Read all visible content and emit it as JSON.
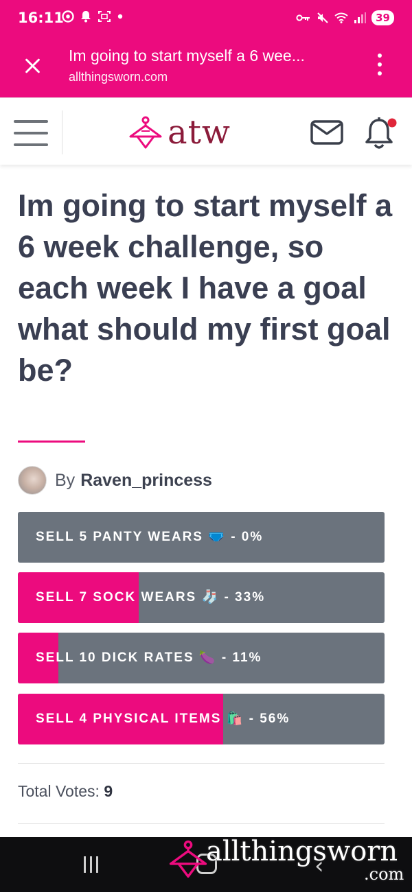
{
  "status_bar": {
    "time": "16:11",
    "battery": "39",
    "left_icons": [
      "chrome-icon",
      "notification-bell-icon",
      "screenshot-icon",
      "dot-icon"
    ],
    "right_icons": [
      "vpn-key-icon",
      "mute-icon",
      "wifi-icon",
      "signal-icon"
    ]
  },
  "tab": {
    "title": "Im going to start myself a 6 wee...",
    "url": "allthingsworn.com"
  },
  "header": {
    "logo_text": "atw",
    "accent_color": "#ec0b7e",
    "logo_color": "#8b1b3a"
  },
  "post": {
    "title": "Im going to start myself a 6 week challenge, so each week I have a goal what should my first goal be?",
    "by_label": "By",
    "author": "Raven_princess"
  },
  "poll": {
    "options": [
      {
        "label": "SELL 5 PANTY WEARS 🩲 - 0%",
        "percent": 0
      },
      {
        "label": "SELL 7 SOCK WEARS 🧦 - 33%",
        "percent": 33
      },
      {
        "label": "SELL 10 DICK RATES 🍆 - 11%",
        "percent": 11
      },
      {
        "label": "SELL 4 PHYSICAL ITEMS 🛍️ - 56%",
        "percent": 56
      }
    ],
    "total_label": "Total Votes:",
    "total_value": "9"
  },
  "watermark": {
    "text": "allthingsworn",
    "suffix": ".com"
  },
  "nav": {
    "back_glyph": "‹"
  }
}
